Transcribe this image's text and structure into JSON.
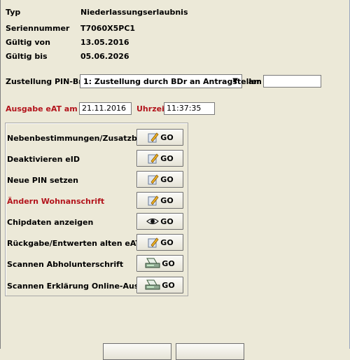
{
  "info": {
    "typ_label": "Typ",
    "typ_value": "Niederlassungserlaubnis",
    "serial_label": "Seriennummer",
    "serial_value": "T7060X5PC1",
    "valid_from_label": "Gültig von",
    "valid_from_value": "13.05.2016",
    "valid_to_label": "Gültig bis",
    "valid_to_value": "05.06.2026"
  },
  "delivery": {
    "label": "Zustellung PIN-Brief",
    "selected_option": "1: Zustellung durch BDr an Antragsteller",
    "am_label": "am",
    "am_value": ""
  },
  "issue": {
    "label": "Ausgabe eAT am",
    "date_value": "21.11.2016",
    "time_label": "Uhrzeit",
    "time_value": "11:37:35"
  },
  "actions": [
    {
      "label": "Nebenbestimmungen/Zusatzblatt",
      "button": "GO",
      "icon": "edit-icon"
    },
    {
      "label": "Deaktivieren eID",
      "button": "GO",
      "icon": "edit-icon"
    },
    {
      "label": "Neue PIN setzen",
      "button": "GO",
      "icon": "edit-icon"
    },
    {
      "label": "Ändern Wohnanschrift",
      "button": "GO",
      "icon": "edit-icon"
    },
    {
      "label": "Chipdaten anzeigen",
      "button": "GO",
      "icon": "eye-icon"
    },
    {
      "label": "Rückgabe/Entwerten alten eAT",
      "button": "GO",
      "icon": "edit-icon"
    },
    {
      "label": "Scannen Abholunterschrift",
      "button": "GO",
      "icon": "scanner-icon"
    },
    {
      "label": "Scannen Erklärung Online-Ausweis",
      "button": "GO",
      "icon": "scanner-icon"
    }
  ],
  "colors": {
    "background": "#ece9d8",
    "highlight_red": "#b3141c"
  }
}
